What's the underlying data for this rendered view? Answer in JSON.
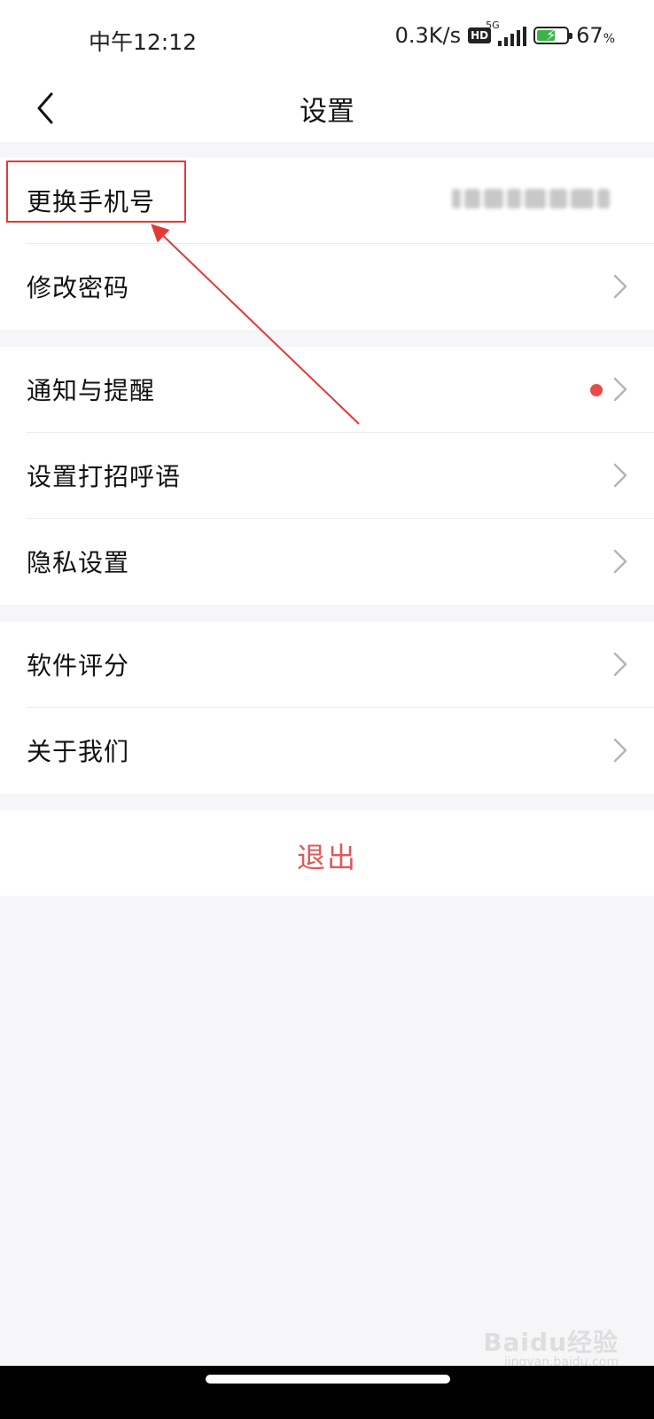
{
  "status_bar": {
    "time": "中午12:12",
    "net_speed": "0.3K/s",
    "hd_badge": "HD",
    "network_type": "5G",
    "battery_percent": "67",
    "battery_unit": "%",
    "battery_level": 0.67
  },
  "nav": {
    "title": "设置",
    "back_icon": "chevron-left-icon"
  },
  "groups": [
    {
      "items": [
        {
          "label": "更换手机号",
          "value_blurred": true
        },
        {
          "label": "修改密码"
        }
      ]
    },
    {
      "items": [
        {
          "label": "通知与提醒",
          "badge_dot": true
        },
        {
          "label": "设置打招呼语"
        },
        {
          "label": "隐私设置"
        }
      ]
    },
    {
      "items": [
        {
          "label": "软件评分"
        },
        {
          "label": "关于我们"
        }
      ]
    }
  ],
  "logout_label": "退出",
  "watermark": {
    "brand": "Baidu经验",
    "url": "jingyan.baidu.com"
  },
  "colors": {
    "accent_red": "#e0585a",
    "annotation_red": "#e23a36",
    "badge_dot": "#e84a4a",
    "background": "#f6f6f8"
  }
}
